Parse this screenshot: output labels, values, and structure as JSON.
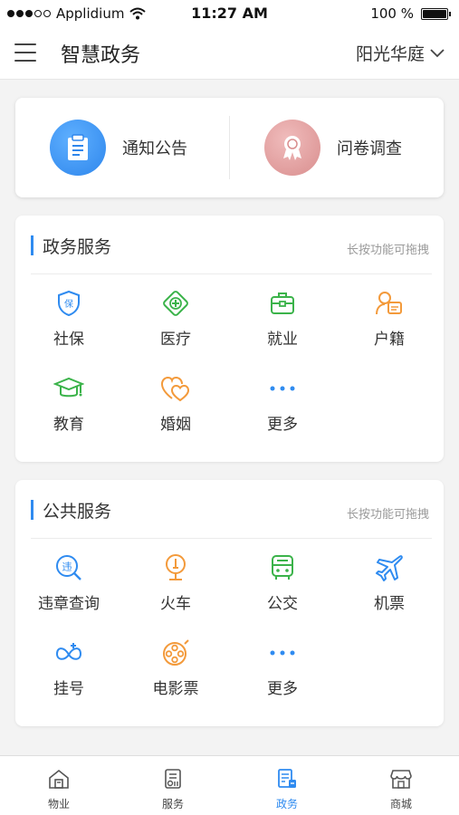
{
  "status_bar": {
    "carrier": "Applidium",
    "time": "11:27 AM",
    "battery": "100 %",
    "battery_level": 1.0
  },
  "header": {
    "title": "智慧政务",
    "community": "阳光华庭",
    "menu_icon": "hamburger-menu-icon",
    "dropdown_icon": "chevron-down-icon"
  },
  "quick_links": [
    {
      "label": "通知公告",
      "icon": "notice-clipboard-icon",
      "color": "#3a95f0"
    },
    {
      "label": "问卷调查",
      "icon": "survey-badge-icon",
      "color": "#e3a4a4"
    }
  ],
  "gov_services": {
    "title": "政务服务",
    "hint": "长按功能可拖拽",
    "items": [
      {
        "label": "社保",
        "icon": "shield-icon",
        "color": "#2f8bf0"
      },
      {
        "label": "医疗",
        "icon": "medical-cross-icon",
        "color": "#3bb34a"
      },
      {
        "label": "就业",
        "icon": "briefcase-icon",
        "color": "#3bb34a"
      },
      {
        "label": "户籍",
        "icon": "household-register-icon",
        "color": "#f39a3b"
      },
      {
        "label": "教育",
        "icon": "graduation-cap-icon",
        "color": "#3bb34a"
      },
      {
        "label": "婚姻",
        "icon": "hearts-icon",
        "color": "#f39a3b"
      },
      {
        "label": "更多",
        "icon": "more-dots-icon",
        "color": "#2f8bf0"
      }
    ]
  },
  "public_services": {
    "title": "公共服务",
    "hint": "长按功能可拖拽",
    "items": [
      {
        "label": "违章查询",
        "icon": "violation-search-icon",
        "color": "#2f8bf0"
      },
      {
        "label": "火车",
        "icon": "train-icon",
        "color": "#f39a3b"
      },
      {
        "label": "公交",
        "icon": "bus-icon",
        "color": "#3bb34a"
      },
      {
        "label": "机票",
        "icon": "airplane-icon",
        "color": "#2f8bf0"
      },
      {
        "label": "挂号",
        "icon": "registration-icon",
        "color": "#2f8bf0"
      },
      {
        "label": "电影票",
        "icon": "film-reel-icon",
        "color": "#f39a3b"
      },
      {
        "label": "更多",
        "icon": "more-dots-icon",
        "color": "#2f8bf0"
      }
    ]
  },
  "tab_bar": {
    "active_color": "#2f8bf0",
    "tabs": [
      {
        "label": "物业",
        "icon": "home-tab-icon",
        "active": false
      },
      {
        "label": "服务",
        "icon": "service-tab-icon",
        "active": false
      },
      {
        "label": "政务",
        "icon": "government-tab-icon",
        "active": true
      },
      {
        "label": "商城",
        "icon": "shop-tab-icon",
        "active": false
      }
    ]
  }
}
